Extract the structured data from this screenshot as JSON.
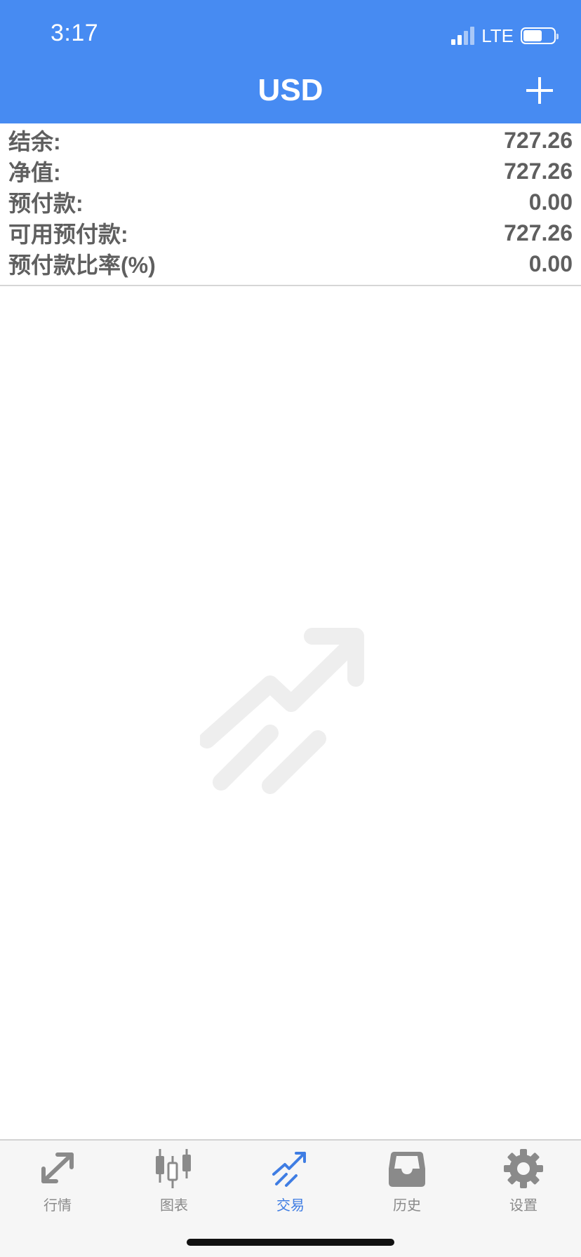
{
  "status_bar": {
    "time": "3:17",
    "network": "LTE"
  },
  "nav": {
    "title": "USD"
  },
  "summary": [
    {
      "label": "结余:",
      "value": "727.26"
    },
    {
      "label": "净值:",
      "value": "727.26"
    },
    {
      "label": "预付款:",
      "value": "0.00"
    },
    {
      "label": "可用预付款:",
      "value": "727.26"
    },
    {
      "label": "预付款比率(%)",
      "value": "0.00"
    }
  ],
  "tabs": [
    {
      "label": "行情",
      "icon": "quotes-arrows-icon",
      "active": false
    },
    {
      "label": "图表",
      "icon": "candlestick-chart-icon",
      "active": false
    },
    {
      "label": "交易",
      "icon": "trade-trend-icon",
      "active": true
    },
    {
      "label": "历史",
      "icon": "history-inbox-icon",
      "active": false
    },
    {
      "label": "设置",
      "icon": "gear-icon",
      "active": false
    }
  ],
  "colors": {
    "header": "#478bf2",
    "active_tab": "#3f7de3",
    "inactive_tab": "#8a8a8a",
    "text": "#5f5f5f"
  }
}
